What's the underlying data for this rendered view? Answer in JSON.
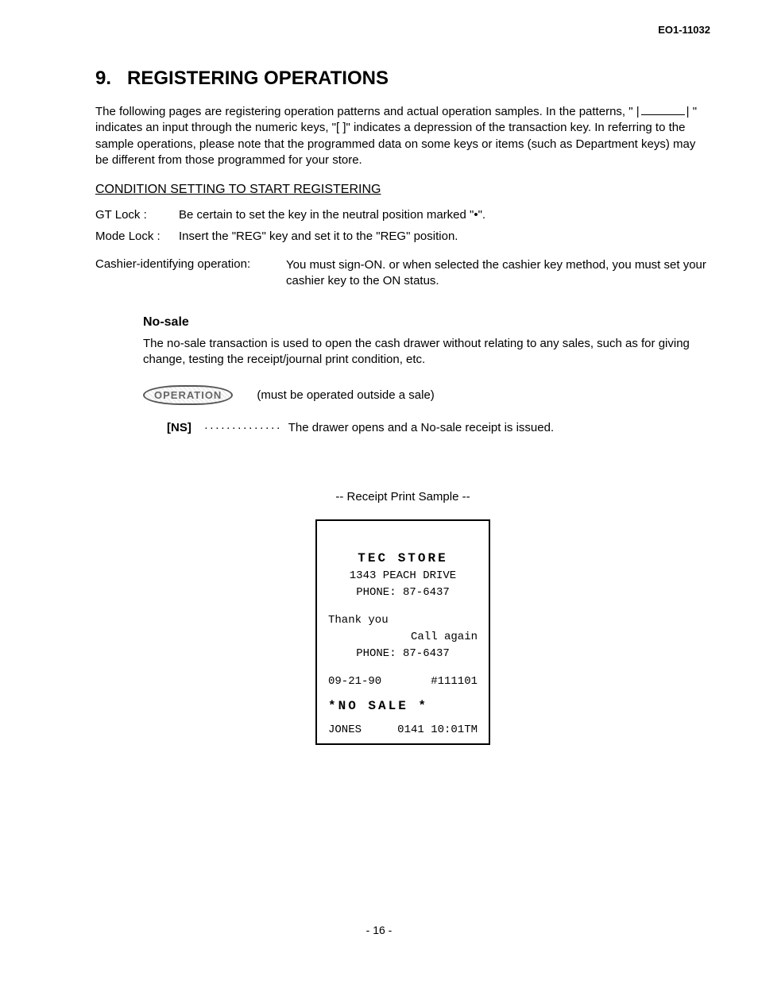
{
  "doc_id": "EO1-11032",
  "section_number": "9.",
  "section_title": "REGISTERING OPERATIONS",
  "intro_before": "The following pages are registering operation patterns and actual operation samples.  In the patterns, \" |",
  "intro_after": "| \" indicates an input through the numeric keys, \"[        ]\" indicates a depression of the transaction key.  In referring to the sample operations, please note that the programmed data on some keys or items (such as Department keys) may be different from those programmed for your store.",
  "cond_heading": "CONDITION SETTING TO START REGISTERING",
  "gt_label": "GT Lock :",
  "gt_text": "Be certain to set the key in the neutral position marked \"•\".",
  "mode_label": "Mode Lock :",
  "mode_text": "Insert the \"REG\" key and set it to the \"REG\" position.",
  "cashier_label": "Cashier-identifying operation:",
  "cashier_text": "You must sign-ON. or when selected the cashier key method, you must set your cashier key to the ON status.",
  "nosale_title": "No-sale",
  "nosale_text": "The no-sale transaction is used to open the cash drawer without relating to any sales, such as for giving change, testing the receipt/journal print condition, etc.",
  "op_badge": "OPERATION",
  "op_note": "(must be operated outside a sale)",
  "ns_key": "[NS]",
  "ns_text": "The drawer opens and a No-sale receipt is issued.",
  "receipt_heading": "-- Receipt Print Sample --",
  "receipt": {
    "store": "TEC  STORE",
    "addr": "1343 PEACH DRIVE",
    "phone1": "PHONE: 87-6437",
    "thank": "Thank you",
    "call": "Call again",
    "phone2": "PHONE: 87-6437",
    "date": "09-21-90",
    "trans": "#111101",
    "nosale": "*NO  SALE  *",
    "cashier": "JONES",
    "seq": "0141",
    "time": "10:01TM"
  },
  "page_num": "- 16 -"
}
